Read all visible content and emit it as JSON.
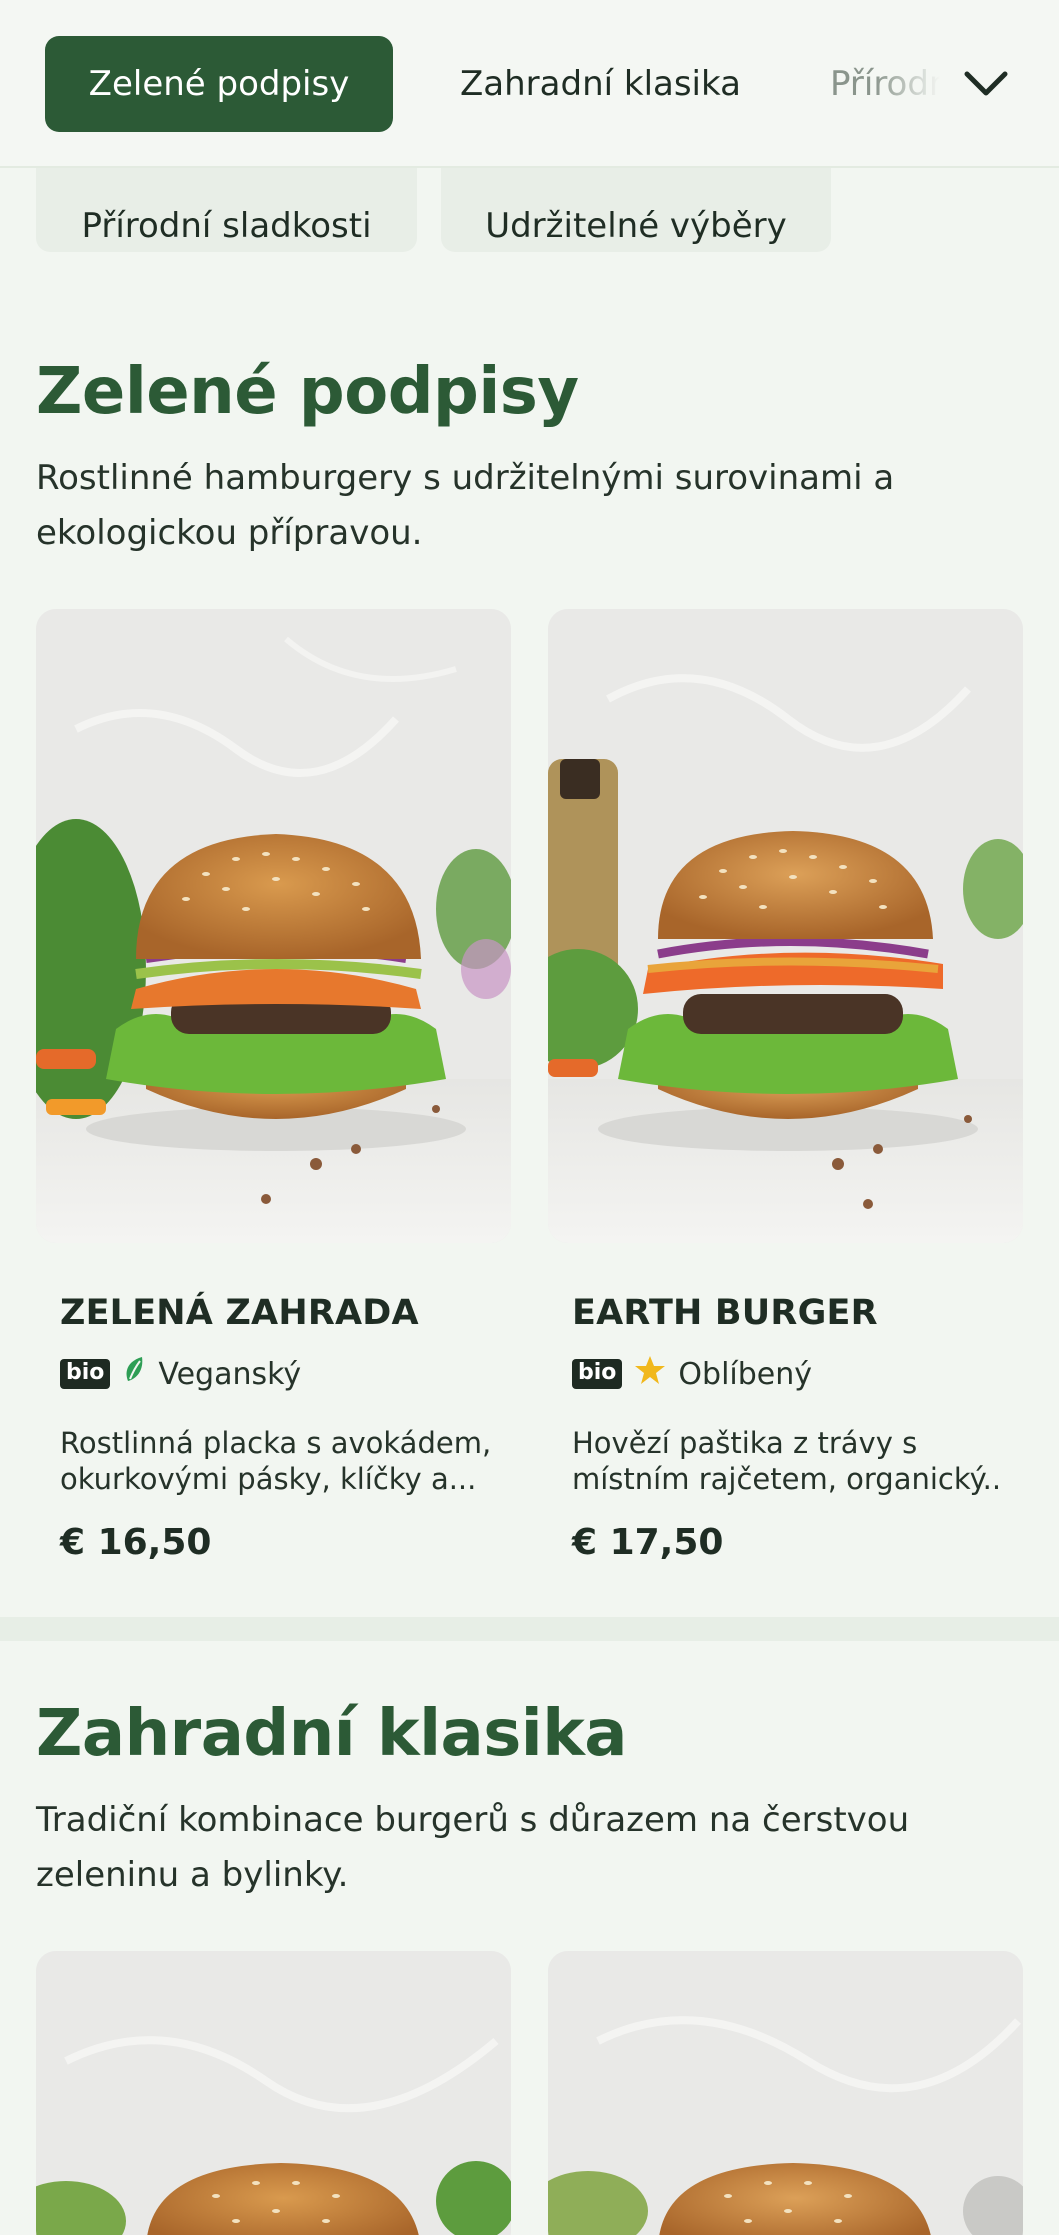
{
  "nav": {
    "tabs": [
      {
        "label": "Zelené podpisy",
        "active": true
      },
      {
        "label": "Zahradní klasika",
        "active": false
      },
      {
        "label": "Přírodní sladkosti",
        "active": false
      }
    ],
    "expand_icon": "chevron-down-icon"
  },
  "chips": [
    "Přírodní sladkosti",
    "Udržitelné výběry"
  ],
  "sections": [
    {
      "title": "Zelené podpisy",
      "description": "Rostlinné hamburgery s udržitelnými surovinami a ekologickou přípravou.",
      "items": [
        {
          "name": "ZELENÁ ZAHRADA",
          "badge": "bio",
          "tag_icon": "leaf-icon",
          "tag": "Veganský",
          "desc_line1": "Rostlinná placka s avokádem,",
          "desc_line2": "okurkovými pásky, klíčky a...",
          "price": "€ 16,50"
        },
        {
          "name": "EARTH BURGER",
          "badge": "bio",
          "tag_icon": "star-icon",
          "tag": "Oblíbený",
          "desc_line1": "Hovězí paštika z trávy s",
          "desc_line2": "místním rajčetem, organický...",
          "price": "€ 17,50"
        }
      ]
    },
    {
      "title": "Zahradní klasika",
      "description": "Tradiční kombinace burgerů s důrazem na čerstvou zeleninu a bylinky."
    }
  ],
  "colors": {
    "brand": "#2c5a36",
    "background": "#f2f6f1",
    "star": "#f1b81c",
    "leaf": "#2e9e55"
  }
}
